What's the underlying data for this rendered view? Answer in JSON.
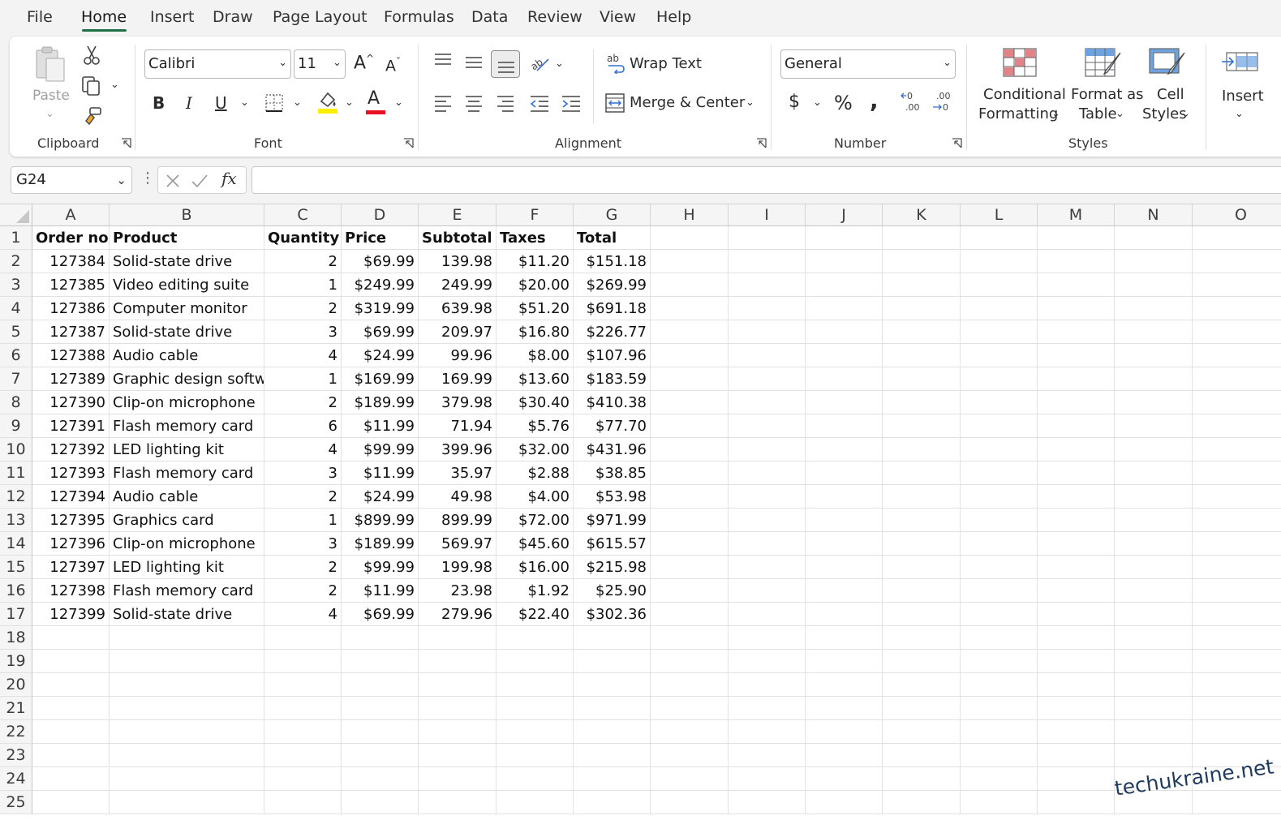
{
  "menu": {
    "tabs": [
      "File",
      "Home",
      "Insert",
      "Draw",
      "Page Layout",
      "Formulas",
      "Data",
      "Review",
      "View",
      "Help"
    ],
    "active": "Home"
  },
  "ribbon": {
    "clipboard": {
      "paste_label": "Paste",
      "group_label": "Clipboard"
    },
    "font": {
      "font_name": "Calibri",
      "font_size": "11",
      "group_label": "Font",
      "highlight_color": "#ffee00",
      "font_color": "#e81123"
    },
    "alignment": {
      "wrap_text_label": "Wrap Text",
      "merge_label": "Merge & Center",
      "group_label": "Alignment"
    },
    "number": {
      "format": "General",
      "group_label": "Number"
    },
    "styles": {
      "conditional_l1": "Conditional",
      "conditional_l2": "Formatting",
      "format_table_l1": "Format as",
      "format_table_l2": "Table",
      "cell_styles_l1": "Cell",
      "cell_styles_l2": "Styles",
      "group_label": "Styles"
    },
    "cells": {
      "insert_label": "Insert"
    }
  },
  "formula_bar": {
    "name_box": "G24",
    "formula": ""
  },
  "sheet": {
    "columns": [
      "A",
      "B",
      "C",
      "D",
      "E",
      "F",
      "G",
      "H",
      "I",
      "J",
      "K",
      "L",
      "M",
      "N",
      "O"
    ],
    "row_numbers": [
      "1",
      "2",
      "3",
      "4",
      "5",
      "6",
      "7",
      "8",
      "9",
      "10",
      "11",
      "12",
      "13",
      "14",
      "15",
      "16",
      "17",
      "18",
      "19",
      "20",
      "21",
      "22",
      "23",
      "24",
      "25"
    ],
    "header_row": [
      "Order no.",
      "Product",
      "Quantity",
      "Price",
      "Subtotal",
      "Taxes",
      "Total"
    ],
    "rows": [
      [
        "127384",
        "Solid-state drive",
        "2",
        "$69.99",
        "139.98",
        "$11.20",
        "$151.18"
      ],
      [
        "127385",
        "Video editing suite",
        "1",
        "$249.99",
        "249.99",
        "$20.00",
        "$269.99"
      ],
      [
        "127386",
        "Computer monitor",
        "2",
        "$319.99",
        "639.98",
        "$51.20",
        "$691.18"
      ],
      [
        "127387",
        "Solid-state drive",
        "3",
        "$69.99",
        "209.97",
        "$16.80",
        "$226.77"
      ],
      [
        "127388",
        "Audio cable",
        "4",
        "$24.99",
        "99.96",
        "$8.00",
        "$107.96"
      ],
      [
        "127389",
        "Graphic design softw",
        "1",
        "$169.99",
        "169.99",
        "$13.60",
        "$183.59"
      ],
      [
        "127390",
        "Clip-on microphone",
        "2",
        "$189.99",
        "379.98",
        "$30.40",
        "$410.38"
      ],
      [
        "127391",
        "Flash memory card",
        "6",
        "$11.99",
        "71.94",
        "$5.76",
        "$77.70"
      ],
      [
        "127392",
        "LED lighting kit",
        "4",
        "$99.99",
        "399.96",
        "$32.00",
        "$431.96"
      ],
      [
        "127393",
        "Flash memory card",
        "3",
        "$11.99",
        "35.97",
        "$2.88",
        "$38.85"
      ],
      [
        "127394",
        "Audio cable",
        "2",
        "$24.99",
        "49.98",
        "$4.00",
        "$53.98"
      ],
      [
        "127395",
        "Graphics card",
        "1",
        "$899.99",
        "899.99",
        "$72.00",
        "$971.99"
      ],
      [
        "127396",
        "Clip-on microphone",
        "3",
        "$189.99",
        "569.97",
        "$45.60",
        "$615.57"
      ],
      [
        "127397",
        "LED lighting kit",
        "2",
        "$99.99",
        "199.98",
        "$16.00",
        "$215.98"
      ],
      [
        "127398",
        "Flash memory card",
        "2",
        "$11.99",
        "23.98",
        "$1.92",
        "$25.90"
      ],
      [
        "127399",
        "Solid-state drive",
        "4",
        "$69.99",
        "279.96",
        "$22.40",
        "$302.36"
      ]
    ]
  },
  "watermark": "techukraine.net",
  "colors": {
    "accent": "#1e7145"
  }
}
